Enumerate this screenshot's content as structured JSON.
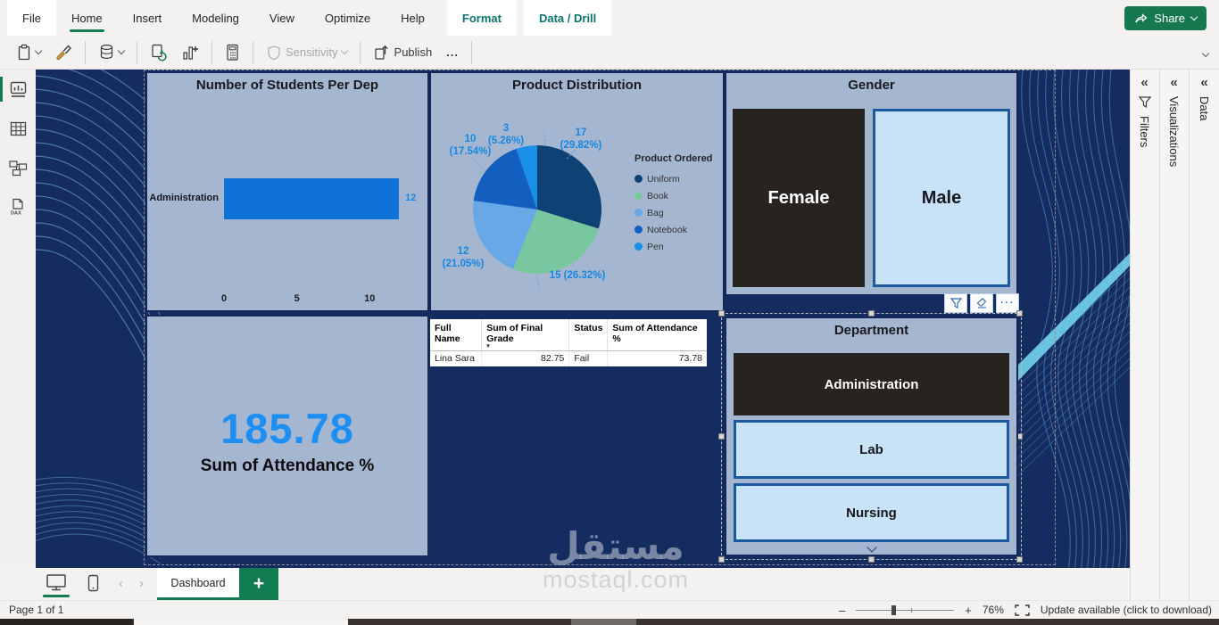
{
  "colors": {
    "accent_green": "#107c50",
    "contextual_teal": "#0a756d",
    "canvas_navy": "#142c60",
    "visual_background": "#a4b6d0",
    "bar_blue": "#0f72d8",
    "card_blue": "#1e8ff2",
    "pie_label_blue": "#1788e0",
    "slicer_selected_dark": "#272320",
    "slicer_unselected_light": "#c8e2f8",
    "slicer_border_blue": "#1b5a9e"
  },
  "menubar": {
    "tabs": [
      {
        "label": "File"
      },
      {
        "label": "Home",
        "active": true
      },
      {
        "label": "Insert"
      },
      {
        "label": "Modeling"
      },
      {
        "label": "View"
      },
      {
        "label": "Optimize"
      },
      {
        "label": "Help"
      },
      {
        "label": "Format",
        "contextual": true
      },
      {
        "label": "Data / Drill",
        "contextual": true
      }
    ],
    "share_label": "Share"
  },
  "ribbon": {
    "buttons": [
      {
        "icon": "paste-icon"
      },
      {
        "icon": "format-painter-icon"
      },
      {
        "icon": "database-icon"
      },
      {
        "icon": "refresh-visual-icon"
      },
      {
        "icon": "new-visual-icon"
      },
      {
        "icon": "calculator-icon"
      },
      {
        "icon": "sensitivity-icon",
        "label": "Sensitivity",
        "disabled": true
      },
      {
        "icon": "publish-icon",
        "label": "Publish"
      },
      {
        "icon": "more-icon",
        "label": "..."
      }
    ]
  },
  "sidebar": {
    "views": [
      {
        "name": "report-view",
        "active": true
      },
      {
        "name": "table-view"
      },
      {
        "name": "model-view"
      },
      {
        "name": "dax-query-view"
      }
    ]
  },
  "right_panels": {
    "panels": [
      {
        "label": "Filters",
        "icon": "filter-funnel-icon"
      },
      {
        "label": "Visualizations"
      },
      {
        "label": "Data"
      }
    ]
  },
  "chart_data": [
    {
      "type": "bar",
      "title": "Number of Students Per Dep",
      "orientation": "horizontal",
      "categories": [
        "Administration"
      ],
      "values": [
        12
      ],
      "data_labels": [
        "12"
      ],
      "xlim": [
        0,
        12
      ],
      "ticks": [
        {
          "label": "0",
          "value": 0
        },
        {
          "label": "5",
          "value": 5
        },
        {
          "label": "10",
          "value": 10
        }
      ],
      "bar_color": "#0f72d8",
      "grid": false
    },
    {
      "type": "pie",
      "title": "Product Distribution",
      "legend_title": "Product Ordered",
      "legend_position": "right",
      "slices": [
        {
          "label": "Uniform",
          "value": 17,
          "pct": "29.82%",
          "color": "#0e4174"
        },
        {
          "label": "Book",
          "value": 15,
          "pct": "26.32%",
          "color": "#78c79e"
        },
        {
          "label": "Bag",
          "value": 12,
          "pct": "21.05%",
          "color": "#68a8e6"
        },
        {
          "label": "Notebook",
          "value": 10,
          "pct": "17.54%",
          "color": "#135fc0"
        },
        {
          "label": "Pen",
          "value": 3,
          "pct": "5.26%",
          "color": "#1790e6"
        }
      ],
      "callouts": [
        "17\n(29.82%)",
        "15 (26.32%)",
        "12\n(21.05%)",
        "10\n(17.54%)",
        "3\n(5.26%)"
      ]
    }
  ],
  "visuals": {
    "gender": {
      "title": "Gender",
      "options": [
        {
          "label": "Female",
          "selected": true
        },
        {
          "label": "Male",
          "selected": false
        }
      ]
    },
    "card": {
      "value": "185.78",
      "label": "Sum of Attendance %"
    },
    "table": {
      "columns": [
        {
          "label": "Full Name",
          "align": "left"
        },
        {
          "label": "Sum of Final Grade",
          "align": "left",
          "sorted": "desc"
        },
        {
          "label": "Status",
          "align": "left"
        },
        {
          "label": "Sum of Attendance %",
          "align": "left"
        }
      ],
      "rows": [
        [
          "Lina Sara",
          "82.75",
          "Fail",
          "73.78"
        ]
      ],
      "cell_align": [
        "left",
        "right",
        "left",
        "right"
      ]
    },
    "department": {
      "title": "Department",
      "options": [
        {
          "label": "Administration",
          "selected": true
        },
        {
          "label": "Lab",
          "selected": false
        },
        {
          "label": "Nursing",
          "selected": false
        }
      ]
    }
  },
  "pagebar": {
    "page_tab": "Dashboard",
    "add_page_label": "+"
  },
  "statusbar": {
    "page_indicator": "Page 1 of 1",
    "zoom_level": "76%",
    "update_message": "Update available (click to download)"
  },
  "watermark": {
    "brand_arabic": "مستقل",
    "brand_latin": "mostaql.com"
  }
}
